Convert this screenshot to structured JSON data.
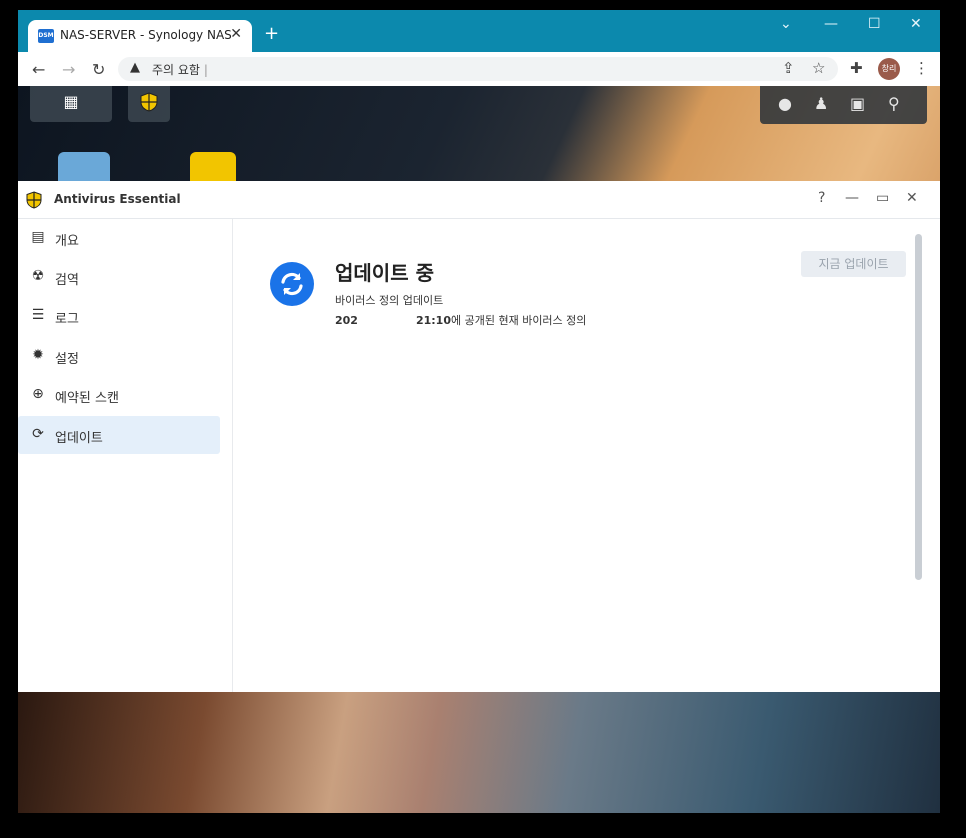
{
  "browser": {
    "tab": {
      "favicon_text": "DSM",
      "title": "NAS-SERVER - Synology NAS",
      "close_glyph": "✕"
    },
    "new_tab_glyph": "+",
    "window_controls": {
      "dropdown": "⌄",
      "minimize": "—",
      "maximize": "☐",
      "close": "✕"
    },
    "omnibox": {
      "security_icon": "warning-icon",
      "security_label": "주의 요함",
      "url": "|"
    },
    "profile_avatar": "창리"
  },
  "desktop": {
    "taskbar_icons": [
      "main-menu-icon",
      "antivirus-icon"
    ],
    "tray_icons": [
      "chat-icon",
      "user-icon",
      "widgets-icon",
      "search-icon"
    ]
  },
  "window": {
    "title": "Antivirus Essential",
    "controls": {
      "help": "?",
      "minimize": "—",
      "maximize": "▭",
      "close": "✕"
    }
  },
  "sidebar": {
    "items": [
      {
        "label": "개요",
        "icon": "overview-icon",
        "glyph": "▤",
        "active": false
      },
      {
        "label": "검역",
        "icon": "quarantine-icon",
        "glyph": "☢",
        "active": false
      },
      {
        "label": "로그",
        "icon": "log-icon",
        "glyph": "☰",
        "active": false
      },
      {
        "label": "설정",
        "icon": "settings-icon",
        "glyph": "✹",
        "active": false
      },
      {
        "label": "예약된 스캔",
        "icon": "scheduled-scan-icon",
        "glyph": "⊕",
        "active": false
      },
      {
        "label": "업데이트",
        "icon": "update-icon",
        "glyph": "⟳",
        "active": true
      }
    ]
  },
  "main": {
    "status_title": "업데이트 중",
    "status_subtitle": "바이러스 정의 업데이트",
    "definition_date": "202",
    "definition_time": "21:10",
    "definition_suffix": "에 공개된 현재 바이러스 정의",
    "update_now_button": "지금 업데이트"
  },
  "colors": {
    "accent": "#1a73e8",
    "chrome_frame": "#0c89ad",
    "active_nav": "#e4effa"
  }
}
